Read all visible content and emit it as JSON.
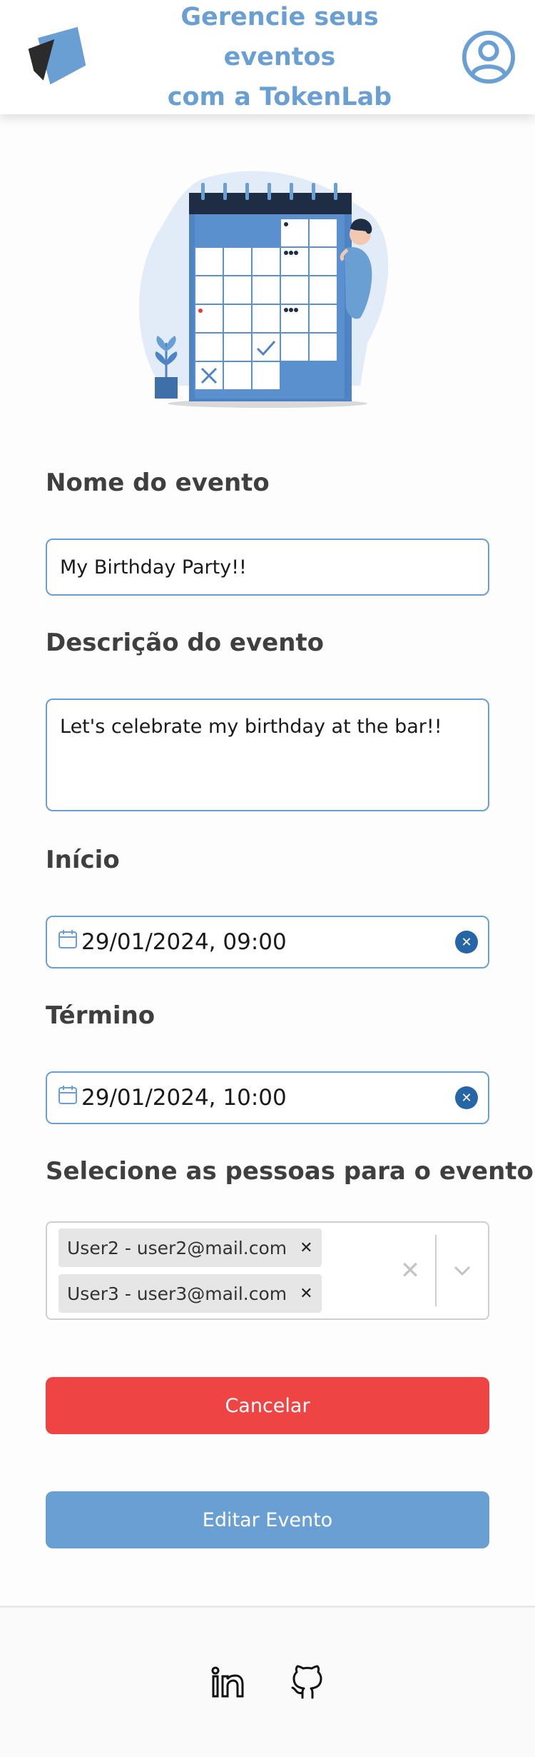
{
  "header": {
    "title_line1": "Gerencie seus eventos",
    "title_line2": "com a TokenLab"
  },
  "form": {
    "name_label": "Nome do evento",
    "name_value": "My Birthday Party!!",
    "description_label": "Descrição do evento",
    "description_value": "Let's celebrate my birthday at the bar!!",
    "start_label": "Início",
    "start_value": "29/01/2024, 09:00",
    "end_label": "Término",
    "end_value": "29/01/2024, 10:00",
    "people_label": "Selecione as pessoas para o evento",
    "selected_people": [
      "User2 - user2@mail.com",
      "User3 - user3@mail.com"
    ]
  },
  "buttons": {
    "cancel_label": "Cancelar",
    "edit_label": "Editar Evento"
  },
  "icons": {
    "logo": "tokenlab-logo",
    "profile": "user-circle-icon",
    "calendar": "calendar-icon",
    "clear": "clear-icon",
    "chevron": "chevron-down-icon",
    "linkedin": "linkedin-icon",
    "github": "github-icon"
  },
  "colors": {
    "primary": "#6a9fd4",
    "danger": "#ef4444",
    "clear_badge": "#2766a6"
  }
}
